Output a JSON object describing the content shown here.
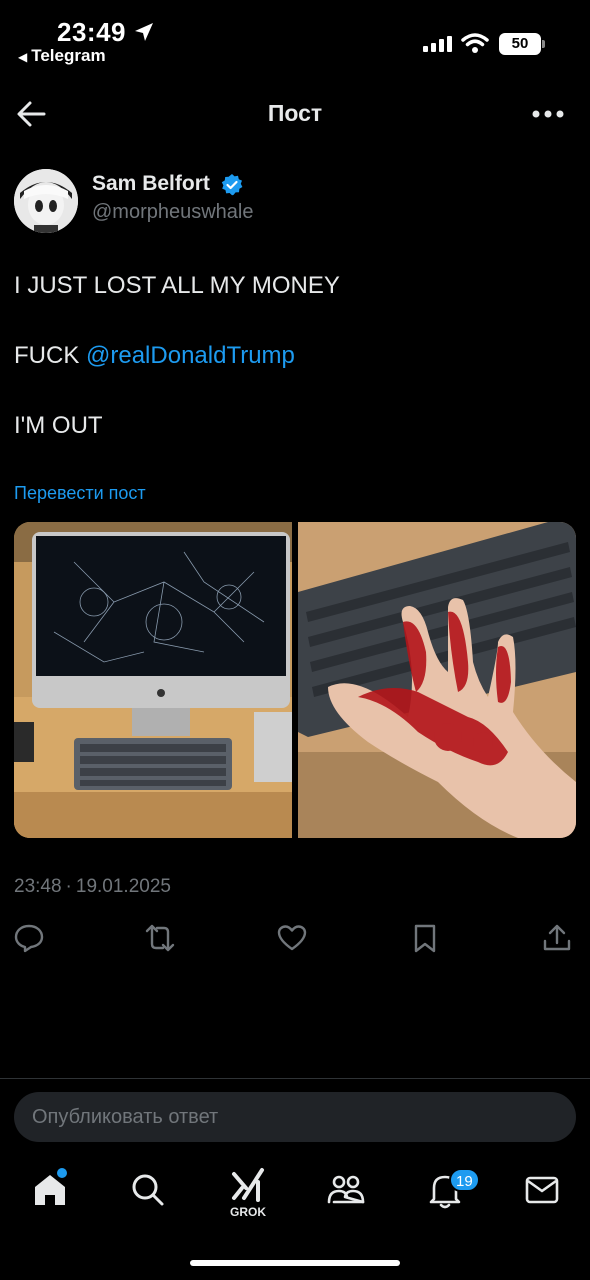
{
  "status_bar": {
    "time": "23:49",
    "back_app": "Telegram",
    "battery": "50"
  },
  "header": {
    "title": "Пост"
  },
  "post": {
    "author_name": "Sam Belfort",
    "handle": "@morpheuswhale",
    "lines": {
      "line1": "I JUST LOST ALL MY MONEY",
      "line2_prefix": "FUCK ",
      "line2_mention": "@realDonaldTrump",
      "line3": "I'M OUT"
    },
    "translate_label": "Перевести пост",
    "time": "23:48",
    "separator": "·",
    "date": "19.01.2025"
  },
  "reply": {
    "placeholder": "Опубликовать ответ"
  },
  "tab_bar": {
    "grok_label": "GROK",
    "notifications_badge": "19"
  },
  "colors": {
    "accent": "#1d9bf0",
    "background": "#000000",
    "text": "#e7e9ea",
    "muted": "#71767b"
  },
  "icons": [
    "location-arrow-icon",
    "signal-icon",
    "wifi-icon",
    "back-arrow-icon",
    "more-icon",
    "verified-icon",
    "reply-icon",
    "retweet-icon",
    "like-icon",
    "bookmark-icon",
    "share-icon",
    "home-icon",
    "search-icon",
    "grok-icon",
    "communities-icon",
    "bell-icon",
    "mail-icon"
  ]
}
